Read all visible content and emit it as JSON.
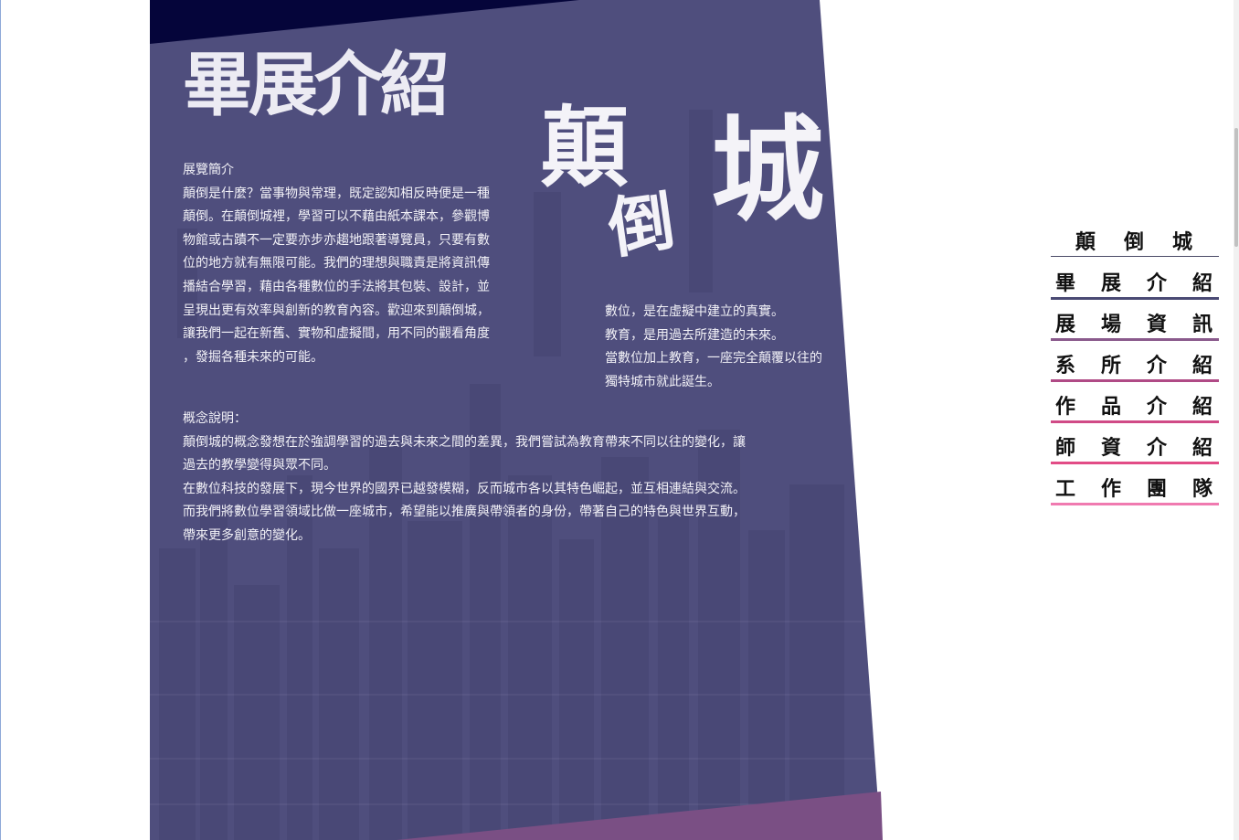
{
  "page": {
    "title": "畢展介紹"
  },
  "logo": {
    "chars": [
      "顛",
      "倒",
      "城"
    ]
  },
  "intro": {
    "heading": "展覽簡介",
    "lines": [
      "顛倒是什麼？當事物與常理，既定認知相反時便是一種",
      "顛倒。在顛倒城裡，學習可以不藉由紙本課本，參觀博",
      "物館或古蹟不一定要亦步亦趨地跟著導覽員，只要有數",
      "位的地方就有無限可能。我們的理想與職責是將資訊傳",
      "播結合學習，藉由各種數位的手法將其包裝、設計，並",
      "呈現出更有效率與創新的教育內容。歡迎來到顛倒城，",
      "讓我們一起在新舊、實物和虛擬間，用不同的觀看角度",
      "，發掘各種未來的可能。"
    ]
  },
  "tagline": {
    "lines": [
      "數位，是在虛擬中建立的真實。",
      "教育，是用過去所建造的未來。",
      "當數位加上教育，一座完全顛覆以往的",
      "獨特城市就此誕生。"
    ]
  },
  "concept": {
    "heading": "概念說明：",
    "lines": [
      "顛倒城的概念發想在於強調學習的過去與未來之間的差異，我們嘗試為教育帶來不同以往的變化，讓",
      "過去的教學變得與眾不同。",
      "在數位科技的發展下，現今世界的國界已越發模糊，反而城市各以其特色崛起，並互相連結與交流。",
      "而我們將數位學習領域比做一座城市，希望能以推廣與帶領者的身份，帶著自己的特色與世界互動，",
      "帶來更多創意的變化。"
    ]
  },
  "nav": {
    "items": [
      {
        "chars": [
          "顛",
          "倒",
          "城"
        ],
        "line_color": "#4a4a66"
      },
      {
        "chars": [
          "畢",
          "展",
          "介",
          "紹"
        ],
        "line_color": "#4a4a74"
      },
      {
        "chars": [
          "展",
          "場",
          "資",
          "訊"
        ],
        "line_color": "#8a5a8c"
      },
      {
        "chars": [
          "系",
          "所",
          "介",
          "紹"
        ],
        "line_color": "#b04a86"
      },
      {
        "chars": [
          "作",
          "品",
          "介",
          "紹"
        ],
        "line_color": "#d04a86"
      },
      {
        "chars": [
          "師",
          "資",
          "介",
          "紹"
        ],
        "line_color": "#e24c86"
      },
      {
        "chars": [
          "工",
          "作",
          "團",
          "隊"
        ],
        "line_color": "#f07ab0"
      }
    ]
  },
  "colors": {
    "panel": "#4f4e7d",
    "panel_top": "#05053a",
    "panel_bottom": "#7a4f84",
    "text": "#f2f1f7"
  }
}
